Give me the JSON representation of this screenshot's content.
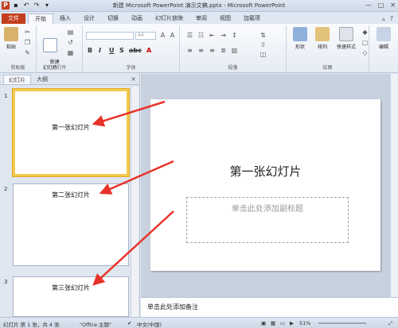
{
  "window": {
    "title": "新建 Microsoft PowerPoint 演示文稿.pptx - Microsoft PowerPoint",
    "controls": [
      "—",
      "□",
      "✕"
    ]
  },
  "ribbon_tabs": [
    "文件",
    "开始",
    "插入",
    "设计",
    "切换",
    "动画",
    "幻灯片放映",
    "审阅",
    "视图",
    "加载项"
  ],
  "ribbon": {
    "clipboard": {
      "paste": "粘贴",
      "label": "剪贴板"
    },
    "slides": {
      "new_slide": "新建\n幻灯片",
      "label": "幻灯片"
    },
    "font": {
      "size_value": "44",
      "label": "字体"
    },
    "paragraph": {
      "label": "段落"
    },
    "drawing": {
      "shapes": "形状",
      "arrange": "排列",
      "quick_styles": "快速样式",
      "label": "绘图"
    },
    "editing": {
      "edit": "编辑"
    }
  },
  "panel": {
    "tabs": [
      "幻灯片",
      "大纲"
    ],
    "close": "×",
    "thumbnails": [
      {
        "num": "1",
        "text": "第一张幻灯片"
      },
      {
        "num": "2",
        "text": "第二张幻灯片"
      },
      {
        "num": "3",
        "text": "第三张幻灯片"
      }
    ]
  },
  "slide": {
    "title": "第一张幻灯片",
    "subtitle_placeholder": "单击此处添加副标题"
  },
  "notes": {
    "placeholder": "单击此处添加备注"
  },
  "status": {
    "slide_info": "幻灯片 第 1 张，共 4 张",
    "theme": "\"Office 主题\"",
    "language": "中文(中国)",
    "zoom": "51%"
  },
  "colors": {
    "file_tab": "#c43e1c",
    "selected_thumb": "#f2c94c",
    "annotation_arrow": "#e8332a"
  }
}
